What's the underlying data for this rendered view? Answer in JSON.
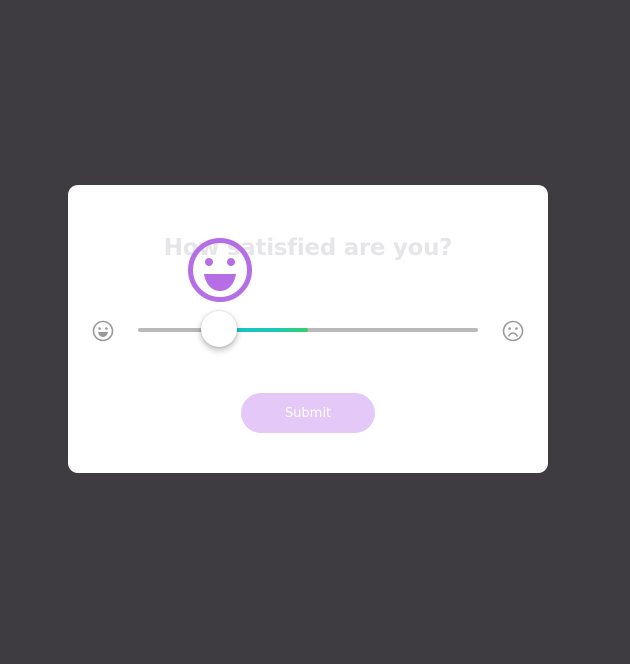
{
  "survey": {
    "question": "How satisfied are you?",
    "submit_label": "Submit"
  },
  "slider": {
    "value_fraction": 0.24,
    "fill_colors": [
      "#1fbfcf",
      "#34d06a"
    ],
    "left_icon": "smile-icon",
    "right_icon": "frown-icon"
  },
  "mood_indicator": {
    "icon": "big-smile-icon",
    "color": "#b56ee6"
  },
  "colors": {
    "background": "#3f3c41",
    "card": "#ffffff",
    "button": "#e4c8f8"
  }
}
